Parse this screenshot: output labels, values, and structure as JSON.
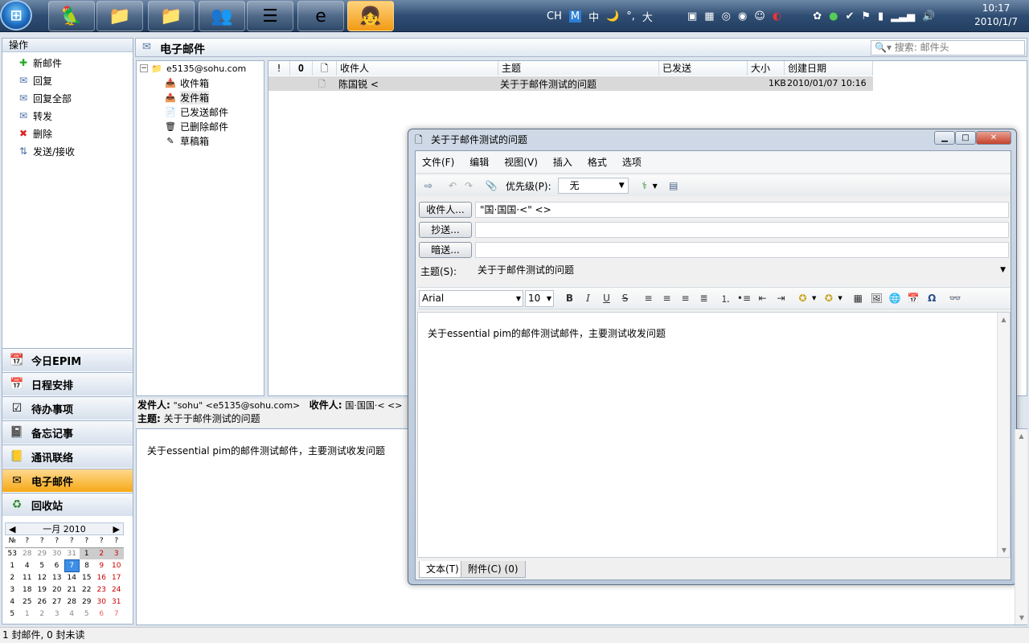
{
  "taskbar": {
    "start_icon": "windows-orb",
    "apps": [
      "parrot-app-icon",
      "explorer-folder-icon",
      "explorer-folder-icon-2",
      "messenger-icon",
      "stack-app-icon",
      "internet-explorer-icon",
      "efficient-pim-icon"
    ],
    "tray_text": [
      "CH",
      "M",
      "中",
      "🌙",
      "°,",
      "大"
    ],
    "time": "10:17",
    "date": "2010/1/7"
  },
  "left": {
    "actions_header": "操作",
    "actions": [
      {
        "label": "新邮件",
        "icon": "plus-icon"
      },
      {
        "label": "回复",
        "icon": "reply-icon"
      },
      {
        "label": "回复全部",
        "icon": "reply-all-icon"
      },
      {
        "label": "转发",
        "icon": "forward-icon"
      },
      {
        "label": "删除",
        "icon": "delete-icon"
      },
      {
        "label": "发送/接收",
        "icon": "send-receive-icon"
      }
    ],
    "nav": [
      "今日EPIM",
      "日程安排",
      "待办事项",
      "备忘记事",
      "通讯联络",
      "电子邮件",
      "回收站"
    ],
    "calendar": {
      "month": "一月",
      "year": "2010",
      "header": [
        "№",
        "?",
        "?",
        "?",
        "?",
        "?",
        "?",
        "?"
      ],
      "weeks": [
        [
          "53",
          "28",
          "29",
          "30",
          "31",
          "1",
          "2",
          "3"
        ],
        [
          "1",
          "4",
          "5",
          "6",
          "7",
          "8",
          "9",
          "10"
        ],
        [
          "2",
          "11",
          "12",
          "13",
          "14",
          "15",
          "16",
          "17"
        ],
        [
          "3",
          "18",
          "19",
          "20",
          "21",
          "22",
          "23",
          "24"
        ],
        [
          "4",
          "25",
          "26",
          "27",
          "28",
          "29",
          "30",
          "31"
        ],
        [
          "5",
          "1",
          "2",
          "3",
          "4",
          "5",
          "6",
          "7"
        ]
      ]
    }
  },
  "main": {
    "title": "电子邮件",
    "search_placeholder": "搜索: 邮件头",
    "account": "e5135@sohu.com",
    "folders": [
      "收件箱",
      "发件箱",
      "已发送邮件",
      "已删除邮件",
      "草稿箱"
    ],
    "columns": [
      "!",
      "",
      "",
      "收件人",
      "主题",
      "已发送",
      "大小",
      "创建日期"
    ],
    "rows": [
      {
        "to": "陈国锐 <",
        "subject": "关于于邮件测试的问题",
        "sent": "",
        "size": "1KB",
        "created": "2010/01/07 10:16"
      }
    ],
    "preview": {
      "from_label": "发件人:",
      "from": "\"sohu\" <e5135@sohu.com>",
      "to_label": "收件人:",
      "to": "国·国国·< <>",
      "subject_label": "主题:",
      "subject": "关于于邮件测试的问题",
      "body": "关于essential pim的邮件测试邮件，主要测试收发问题"
    }
  },
  "status": "1 封邮件, 0 封未读",
  "compose": {
    "title": "关于于邮件测试的问题",
    "menu": [
      "文件(F)",
      "编辑",
      "视图(V)",
      "插入",
      "格式",
      "选项"
    ],
    "priority_label": "优先级(P):",
    "priority_value": "无",
    "to_button": "收件人...",
    "to_value": "\"国·国国·<\" <>",
    "cc_button": "抄送...",
    "cc_value": "",
    "bcc_button": "暗送...",
    "bcc_value": "",
    "subject_label": "主题(S):",
    "subject_value": "关于于邮件测试的问题",
    "font": "Arial",
    "size": "10",
    "body": "关于essential pim的邮件测试邮件，主要测试收发问题",
    "tab_text": "文本(T)",
    "tab_attach": "附件(C) (0)"
  }
}
